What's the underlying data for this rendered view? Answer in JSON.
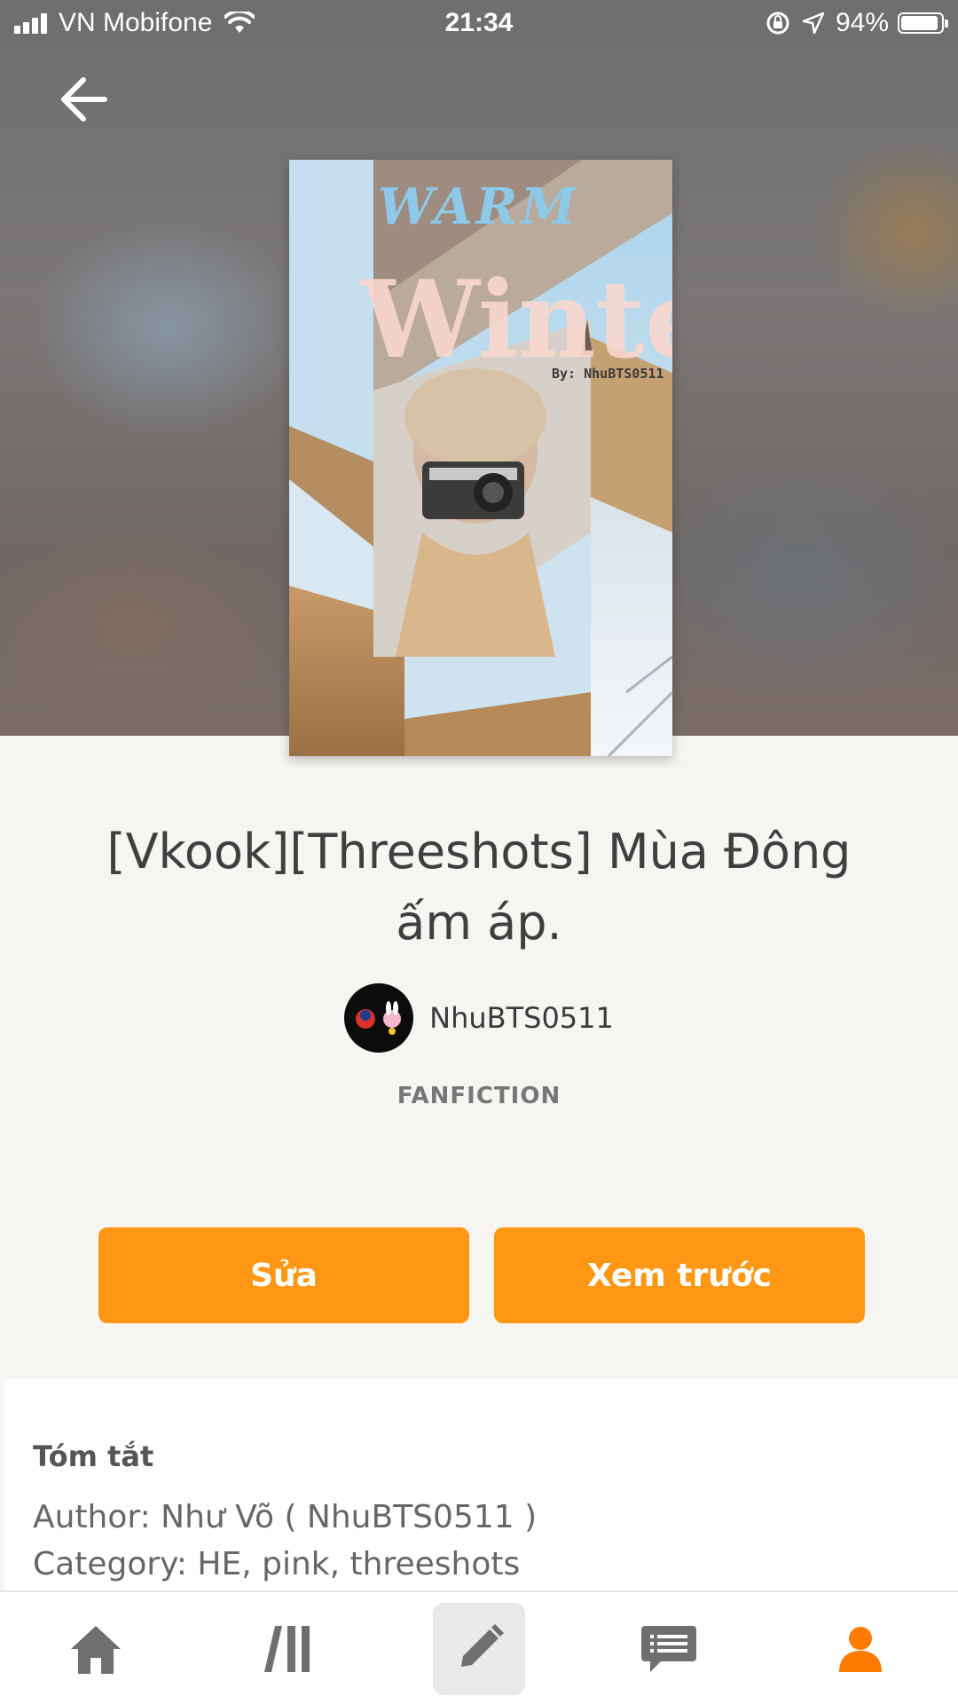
{
  "status_bar": {
    "carrier": "VN Mobifone",
    "time": "21:34",
    "battery": "94%",
    "battery_level": 0.94
  },
  "cover": {
    "title_line1": "WARM",
    "title_line2": "Winter",
    "byline": "By: NhuBTS0511"
  },
  "story": {
    "title": "[Vkook][Threeshots] Mùa Đông ấm áp.",
    "author": "NhuBTS0511",
    "category": "FANFICTION"
  },
  "actions": {
    "edit_label": "Sửa",
    "preview_label": "Xem trước"
  },
  "summary": {
    "heading": "Tóm tắt",
    "line1": "Author: Như Võ ( NhuBTS0511 )",
    "line2": "Category: HE, pink, threeshots"
  },
  "nav": {
    "items": [
      "home-icon",
      "library-icon",
      "pencil-icon",
      "messages-icon",
      "profile-icon"
    ],
    "active": "profile-icon"
  },
  "colors": {
    "accent": "#ff9714",
    "active_nav": "#ff7a00",
    "inactive_nav": "#6f6f6f"
  }
}
